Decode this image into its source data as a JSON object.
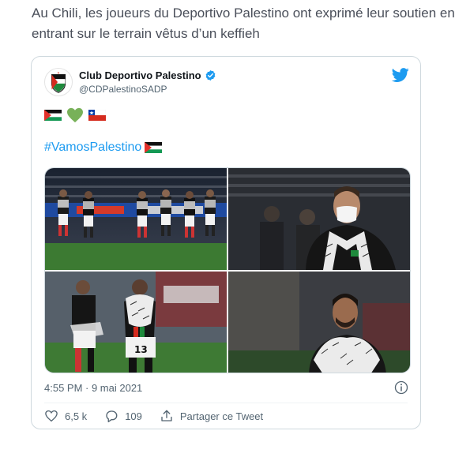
{
  "article": {
    "line1": "Au Chili, les joueurs du Deportivo Palestino ont exprimé leur soutien en",
    "line2": "entrant sur le terrain vêtus d’un keffieh"
  },
  "tweet": {
    "name": "Club Deportivo Palestino",
    "handle": "@CDPalestinoSADP",
    "hashtag": "#VamosPalestino",
    "emojis": [
      "palestine-flag",
      "green-heart",
      "chile-flag"
    ],
    "images": [
      {
        "name": "photo-team-on-field"
      },
      {
        "name": "photo-coach-keffiyeh"
      },
      {
        "name": "photo-player-13-keffiyeh"
      },
      {
        "name": "photo-player-keffiyeh"
      }
    ],
    "timestamp": "4:55 PM · 9 mai 2021",
    "likes": "6,5 k",
    "replies": "109",
    "share_label": "Partager ce Tweet"
  },
  "colors": {
    "twitter_blue": "#1d9bf0",
    "text_gray": "#536471",
    "border": "#cfd9de"
  }
}
